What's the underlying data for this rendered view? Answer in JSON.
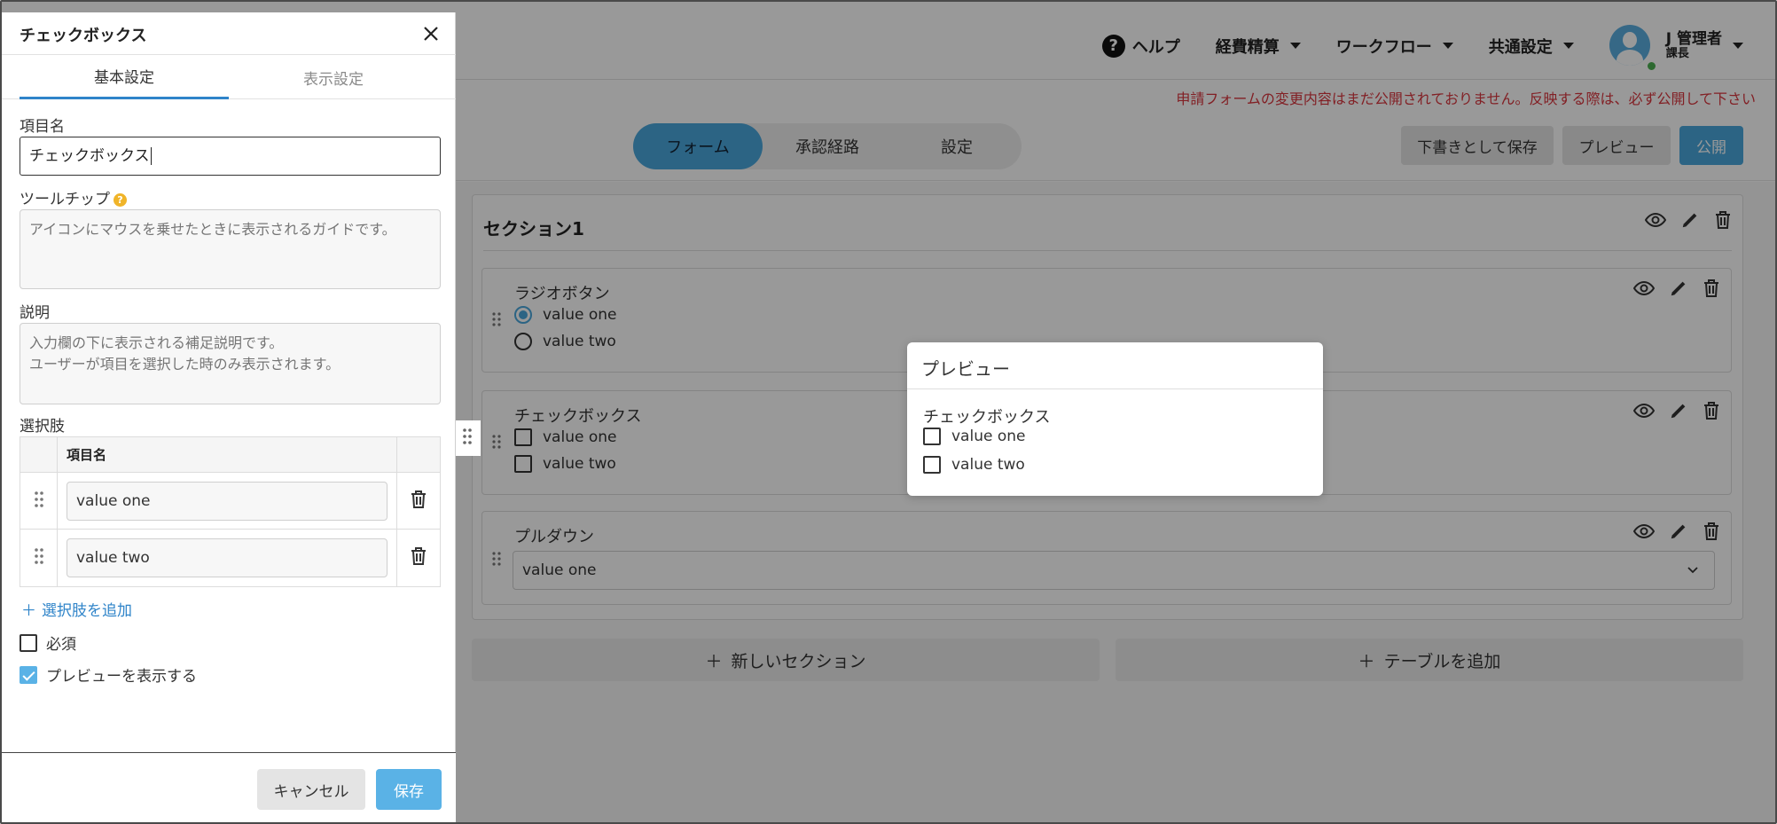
{
  "header": {
    "help": "ヘルプ",
    "nav": [
      "経費精算",
      "ワークフロー",
      "共通設定"
    ],
    "user_name": "J 管理者",
    "user_role": "課長"
  },
  "warning": "申請フォームの変更内容はまだ公開されておりません。反映する際は、必ず公開して下さい",
  "subbar": {
    "tabs": [
      "フォーム",
      "承認経路",
      "設定"
    ],
    "active_tab": "フォーム",
    "save_draft": "下書きとして保存",
    "preview": "プレビュー",
    "publish": "公開"
  },
  "section": {
    "title": "セクション1",
    "fields": [
      {
        "label": "ラジオボタン",
        "type": "radio",
        "options": [
          "value one",
          "value two"
        ],
        "selected": "value one"
      },
      {
        "label": "チェックボックス",
        "type": "checkbox",
        "options": [
          "value one",
          "value two"
        ]
      },
      {
        "label": "プルダウン",
        "type": "select",
        "value": "value one"
      }
    ]
  },
  "add_section": "新しいセクション",
  "add_table": "テーブルを追加",
  "preview_modal": {
    "title": "プレビュー",
    "field_label": "チェックボックス",
    "options": [
      "value one",
      "value two"
    ]
  },
  "panel": {
    "title": "チェックボックス",
    "tabs": [
      "基本設定",
      "表示設定"
    ],
    "item_name_label": "項目名",
    "item_name_value": "チェックボックス",
    "tooltip_label": "ツールチップ",
    "tooltip_placeholder": "アイコンにマウスを乗せたときに表示されるガイドです。",
    "description_label": "説明",
    "description_placeholder": "入力欄の下に表示される補足説明です。\nユーザーが項目を選択した時のみ表示されます。",
    "options_label": "選択肢",
    "options_col_header": "項目名",
    "options": [
      "value one",
      "value two"
    ],
    "add_option": "選択肢を追加",
    "required_label": "必須",
    "required": false,
    "show_preview_label": "プレビューを表示する",
    "show_preview": true,
    "cancel": "キャンセル",
    "save": "保存"
  },
  "colors": {
    "accent": "#4aa7dc",
    "warning": "#d9363e",
    "tab_underline": "#2f84c9"
  }
}
